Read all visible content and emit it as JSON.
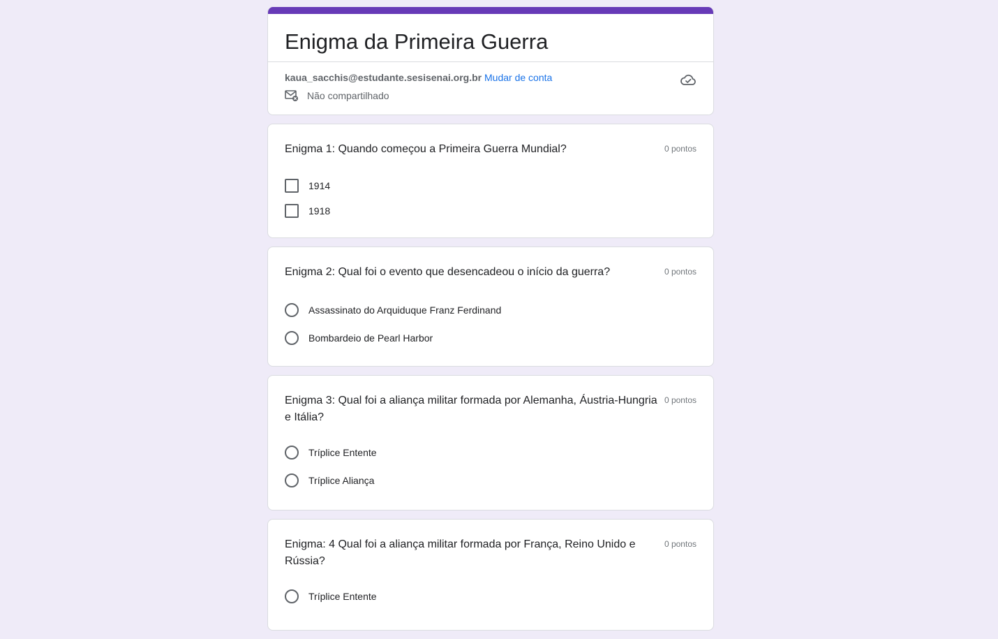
{
  "header": {
    "title": "Enigma da Primeira Guerra",
    "email": "kaua_sacchis@estudante.sesisenai.org.br",
    "switch_account": "Mudar de conta",
    "not_shared": "Não compartilhado",
    "accent_color": "#673ab7",
    "icons": [
      "mail-not-shared-icon",
      "cloud-saved-icon"
    ]
  },
  "questions": [
    {
      "title": "Enigma 1: Quando começou a Primeira Guerra Mundial?",
      "points": "0 pontos",
      "type": "checkbox",
      "options": [
        "1914",
        "1918"
      ]
    },
    {
      "title": "Enigma 2: Qual foi o evento que desencadeou o início da guerra?",
      "points": "0 pontos",
      "type": "radio",
      "options": [
        "Assassinato do Arquiduque Franz Ferdinand",
        "Bombardeio de Pearl Harbor"
      ]
    },
    {
      "title": "Enigma 3: Qual foi a aliança militar formada por Alemanha, Áustria-Hungria e Itália?",
      "points": "0 pontos",
      "type": "radio",
      "options": [
        "Tríplice Entente",
        "Tríplice Aliança"
      ]
    },
    {
      "title": "Enigma: 4 Qual foi a aliança militar formada por França, Reino Unido e Rússia?",
      "points": "0 pontos",
      "type": "radio",
      "options": [
        "Tríplice Entente"
      ]
    }
  ]
}
